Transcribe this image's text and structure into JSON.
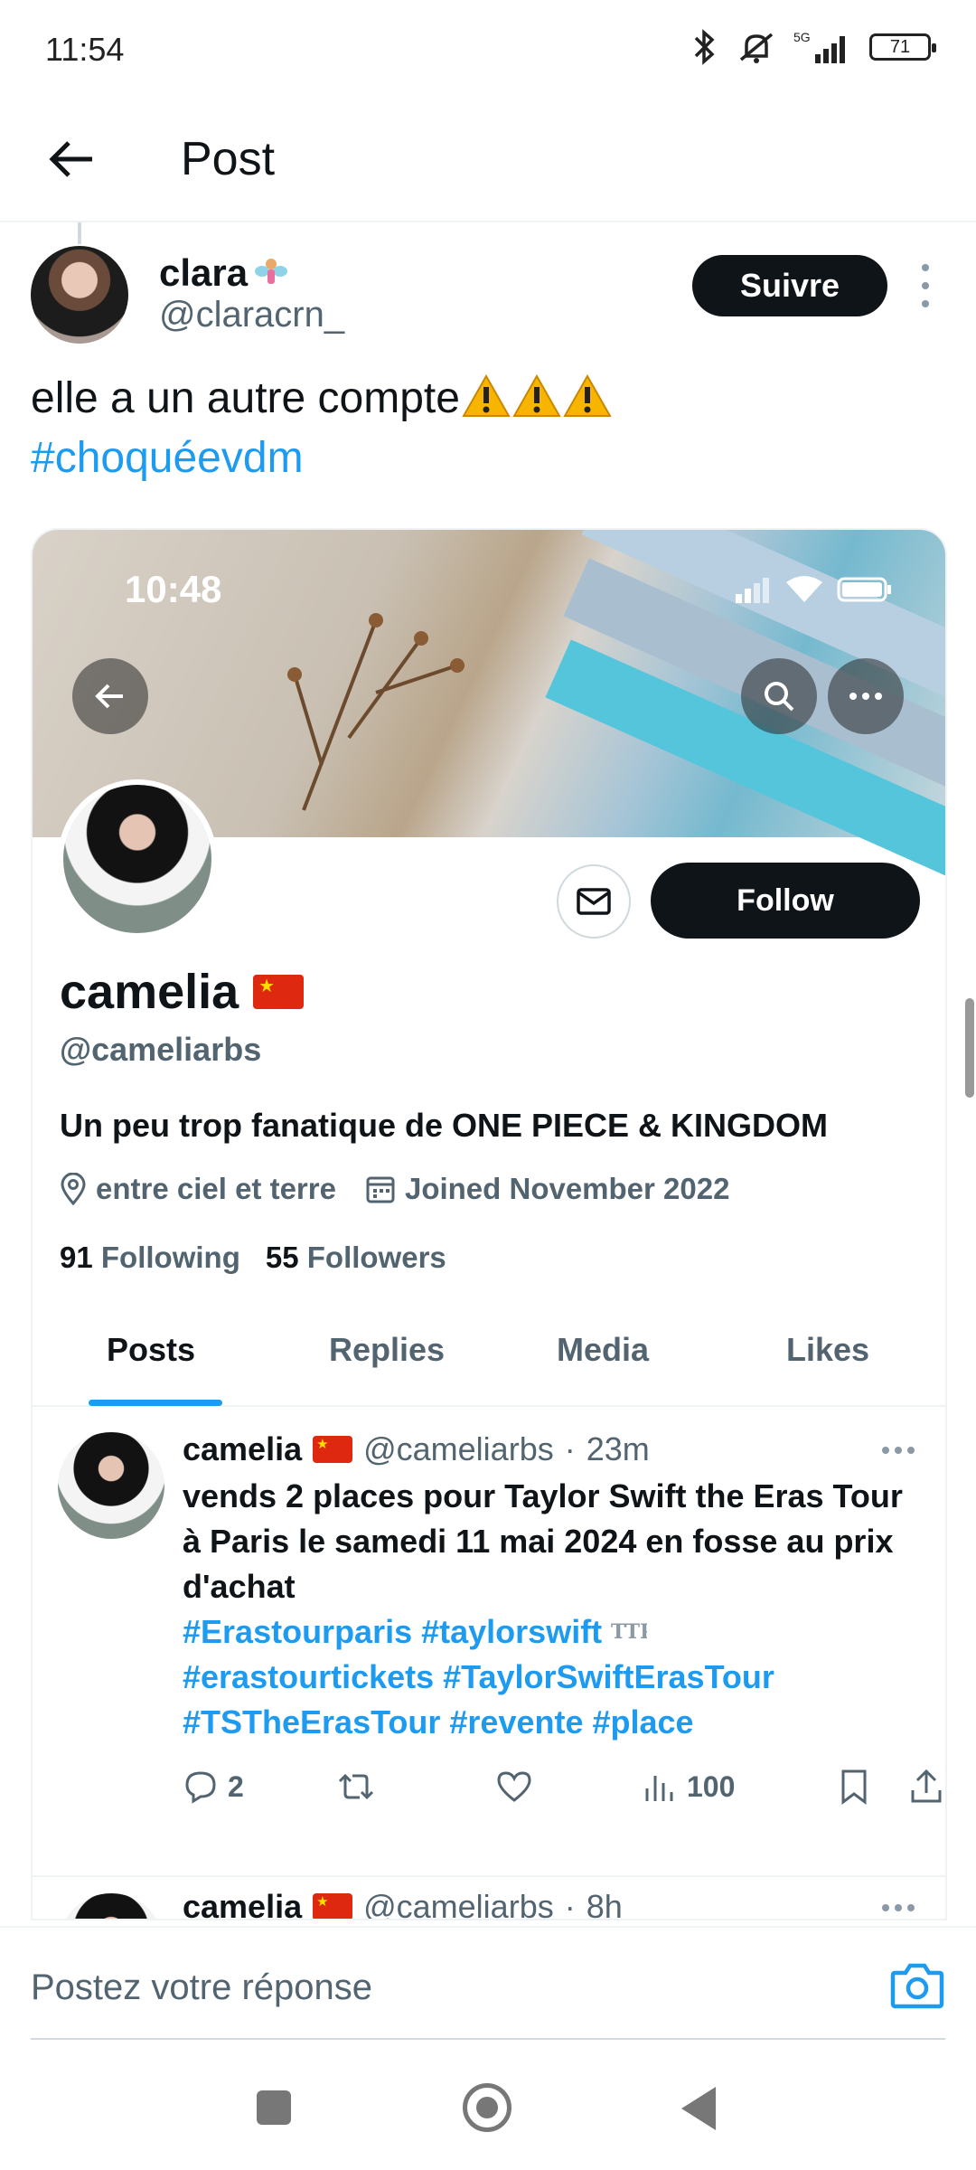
{
  "status_bar": {
    "time": "11:54",
    "network": "5G",
    "battery": "71"
  },
  "header": {
    "title": "Post"
  },
  "tweet": {
    "author_name": "clara",
    "author_handle": "@claracrn_",
    "follow_label": "Suivre",
    "text": "elle a un autre compte",
    "hashtag": "#choquéevdm"
  },
  "embedded": {
    "status_time": "10:48",
    "profile": {
      "name": "camelia",
      "handle": "@cameliarbs",
      "bio": "Un peu trop fanatique de ONE PIECE & KINGDOM",
      "location": "entre ciel et terre",
      "joined": "Joined November 2022",
      "following_count": "91",
      "following_label": "Following",
      "followers_count": "55",
      "followers_label": "Followers",
      "follow_label": "Follow"
    },
    "tabs": [
      {
        "label": "Posts"
      },
      {
        "label": "Replies"
      },
      {
        "label": "Media"
      },
      {
        "label": "Likes"
      }
    ],
    "posts": [
      {
        "name": "camelia",
        "handle": "@cameliarbs",
        "sep": "·",
        "time": "23m",
        "text": "vends 2 places pour Taylor Swift the Eras Tour à Paris le samedi 11 mai 2024 en fosse au prix d'achat",
        "tags_line1": "#Erastourparis #taylorswift",
        "tags_line2": "#erastourtickets #TaylorSwiftErasTour",
        "tags_line3": "#TSTheErasTour #revente #place",
        "replies": "2",
        "views": "100"
      },
      {
        "name": "camelia",
        "handle": "@cameliarbs",
        "sep": "·",
        "time": "8h"
      }
    ]
  },
  "reply_bar": {
    "placeholder": "Postez votre réponse"
  },
  "colors": {
    "accent": "#1d9bf0",
    "text": "#0f1419",
    "muted": "#536471",
    "button": "#0f1419"
  }
}
